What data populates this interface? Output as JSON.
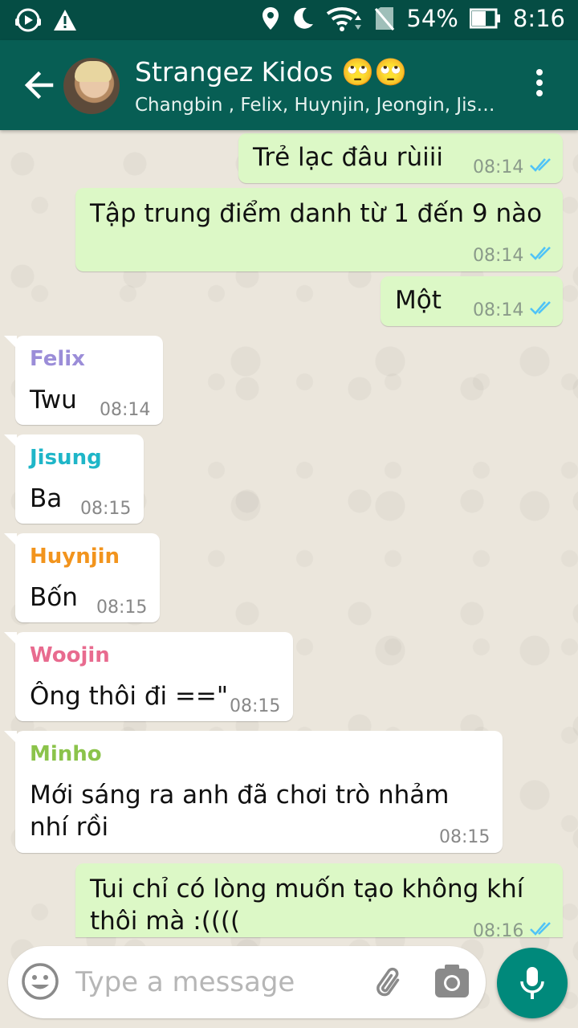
{
  "status_bar": {
    "battery": "54%",
    "time": "8:16"
  },
  "chat": {
    "title": "Strangez Kidos 🙄🙄",
    "participants": "Changbin , Felix, Huynjin, Jeongin, Jisu..."
  },
  "messages": [
    {
      "direction": "out",
      "text": "Trẻ lạc đâu rùiii",
      "time": "08:14",
      "status": "read"
    },
    {
      "direction": "out",
      "text": "Tập trung điểm danh từ 1 đến 9 nào",
      "time": "08:14",
      "status": "read"
    },
    {
      "direction": "out",
      "text": "Một",
      "time": "08:14",
      "status": "read"
    },
    {
      "direction": "in",
      "sender": "Felix",
      "sender_color": "#9b8dd8",
      "text": "Twu",
      "time": "08:14"
    },
    {
      "direction": "in",
      "sender": "Jisung",
      "sender_color": "#1fb6c8",
      "text": "Ba",
      "time": "08:15"
    },
    {
      "direction": "in",
      "sender": "Huynjin",
      "sender_color": "#f2941d",
      "text": "Bốn",
      "time": "08:15"
    },
    {
      "direction": "in",
      "sender": "Woojin",
      "sender_color": "#e86b8f",
      "text": "Ông thôi đi ==\"",
      "time": "08:15"
    },
    {
      "direction": "in",
      "sender": "Minho",
      "sender_color": "#8bc34a",
      "text_lines": [
        "Mới sáng ra anh đã chơi trò nhảm",
        "nhí rồi"
      ],
      "time": "08:15"
    },
    {
      "direction": "out",
      "text_lines": [
        "Tui chỉ có lòng muốn tạo không khí",
        "thôi mà :(((("
      ],
      "time": "08:16",
      "status": "read"
    }
  ],
  "input": {
    "placeholder": "Type a message"
  },
  "colors": {
    "header": "#075e54",
    "status_bar": "#054d44",
    "outgoing_bubble": "#dcf8c6",
    "incoming_bubble": "#ffffff",
    "read_ticks": "#4fc3f7",
    "mic_button": "#00897b"
  }
}
